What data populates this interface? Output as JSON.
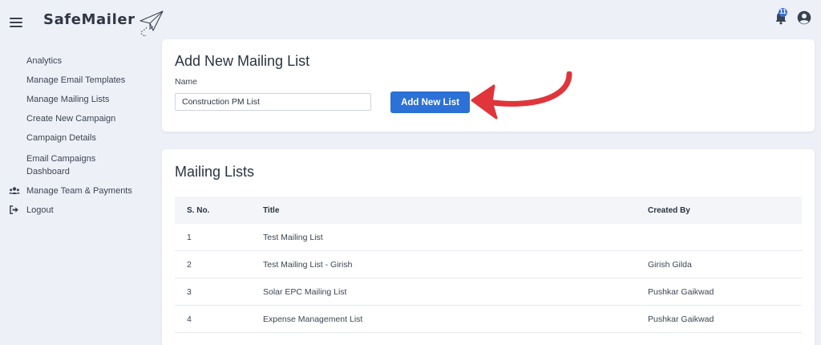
{
  "brand": {
    "name": "SafeMailer"
  },
  "header": {
    "notification_count": "11"
  },
  "sidebar": {
    "items": [
      {
        "label": "Analytics",
        "icon": ""
      },
      {
        "label": "Manage Email Templates",
        "icon": ""
      },
      {
        "label": "Manage Mailing Lists",
        "icon": ""
      },
      {
        "label": "Create New Campaign",
        "icon": ""
      },
      {
        "label": "Campaign Details",
        "icon": ""
      },
      {
        "label": "Email Campaigns Dashboard",
        "icon": ""
      },
      {
        "label": "Manage Team & Payments",
        "icon": "users-icon"
      },
      {
        "label": "Logout",
        "icon": "logout-icon"
      }
    ]
  },
  "add_card": {
    "title": "Add New Mailing List",
    "name_label": "Name",
    "name_value": "Construction PM List",
    "button_label": "Add New List"
  },
  "list_card": {
    "title": "Mailing Lists",
    "columns": [
      "S. No.",
      "Title",
      "Created By"
    ],
    "rows": [
      {
        "sno": "1",
        "title": "Test Mailing List",
        "created_by": ""
      },
      {
        "sno": "2",
        "title": "Test Mailing List - Girish",
        "created_by": "Girish Gilda"
      },
      {
        "sno": "3",
        "title": "Solar EPC Mailing List",
        "created_by": "Pushkar Gaikwad"
      },
      {
        "sno": "4",
        "title": "Expense Management List",
        "created_by": "Pushkar Gaikwad"
      }
    ]
  },
  "colors": {
    "accent": "#2c71d6",
    "arrow": "#e0353b",
    "background": "#edf0f7"
  }
}
